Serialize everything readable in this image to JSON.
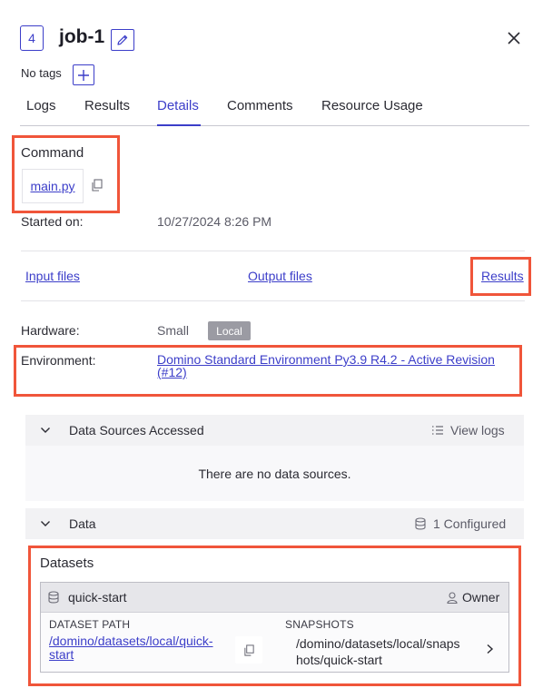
{
  "header": {
    "job_number": "4",
    "title": "job-1",
    "no_tags": "No tags"
  },
  "tabs": [
    {
      "label": "Logs"
    },
    {
      "label": "Results"
    },
    {
      "label": "Details",
      "active": true
    },
    {
      "label": "Comments"
    },
    {
      "label": "Resource Usage"
    }
  ],
  "command": {
    "label": "Command",
    "value": "main.py"
  },
  "started": {
    "label": "Started on:",
    "value": "10/27/2024 8:26 PM"
  },
  "file_links": {
    "input": "Input files",
    "output": "Output files",
    "results": "Results"
  },
  "hardware": {
    "label": "Hardware:",
    "value": "Small",
    "badge": "Local"
  },
  "environment": {
    "label": "Environment:",
    "line1": "Domino Standard Environment Py3.9 R4.2 - Active Revision",
    "line2": "(#12)"
  },
  "data_sources": {
    "title": "Data Sources Accessed",
    "view_logs": "View logs",
    "empty": "There are no data sources."
  },
  "data": {
    "title": "Data",
    "configured": "1 Configured"
  },
  "datasets": {
    "heading": "Datasets",
    "name": "quick-start",
    "role": "Owner",
    "path_label": "DATASET PATH",
    "path_line1": "/domino/datasets/local/quick-",
    "path_line2": "start",
    "snapshots_label": "SNAPSHOTS",
    "snap_line1": "/domino/datasets/local/snaps",
    "snap_line2": "hots/quick-start"
  },
  "colors": {
    "accent": "#3c3ec9",
    "highlight": "#f0553a"
  }
}
